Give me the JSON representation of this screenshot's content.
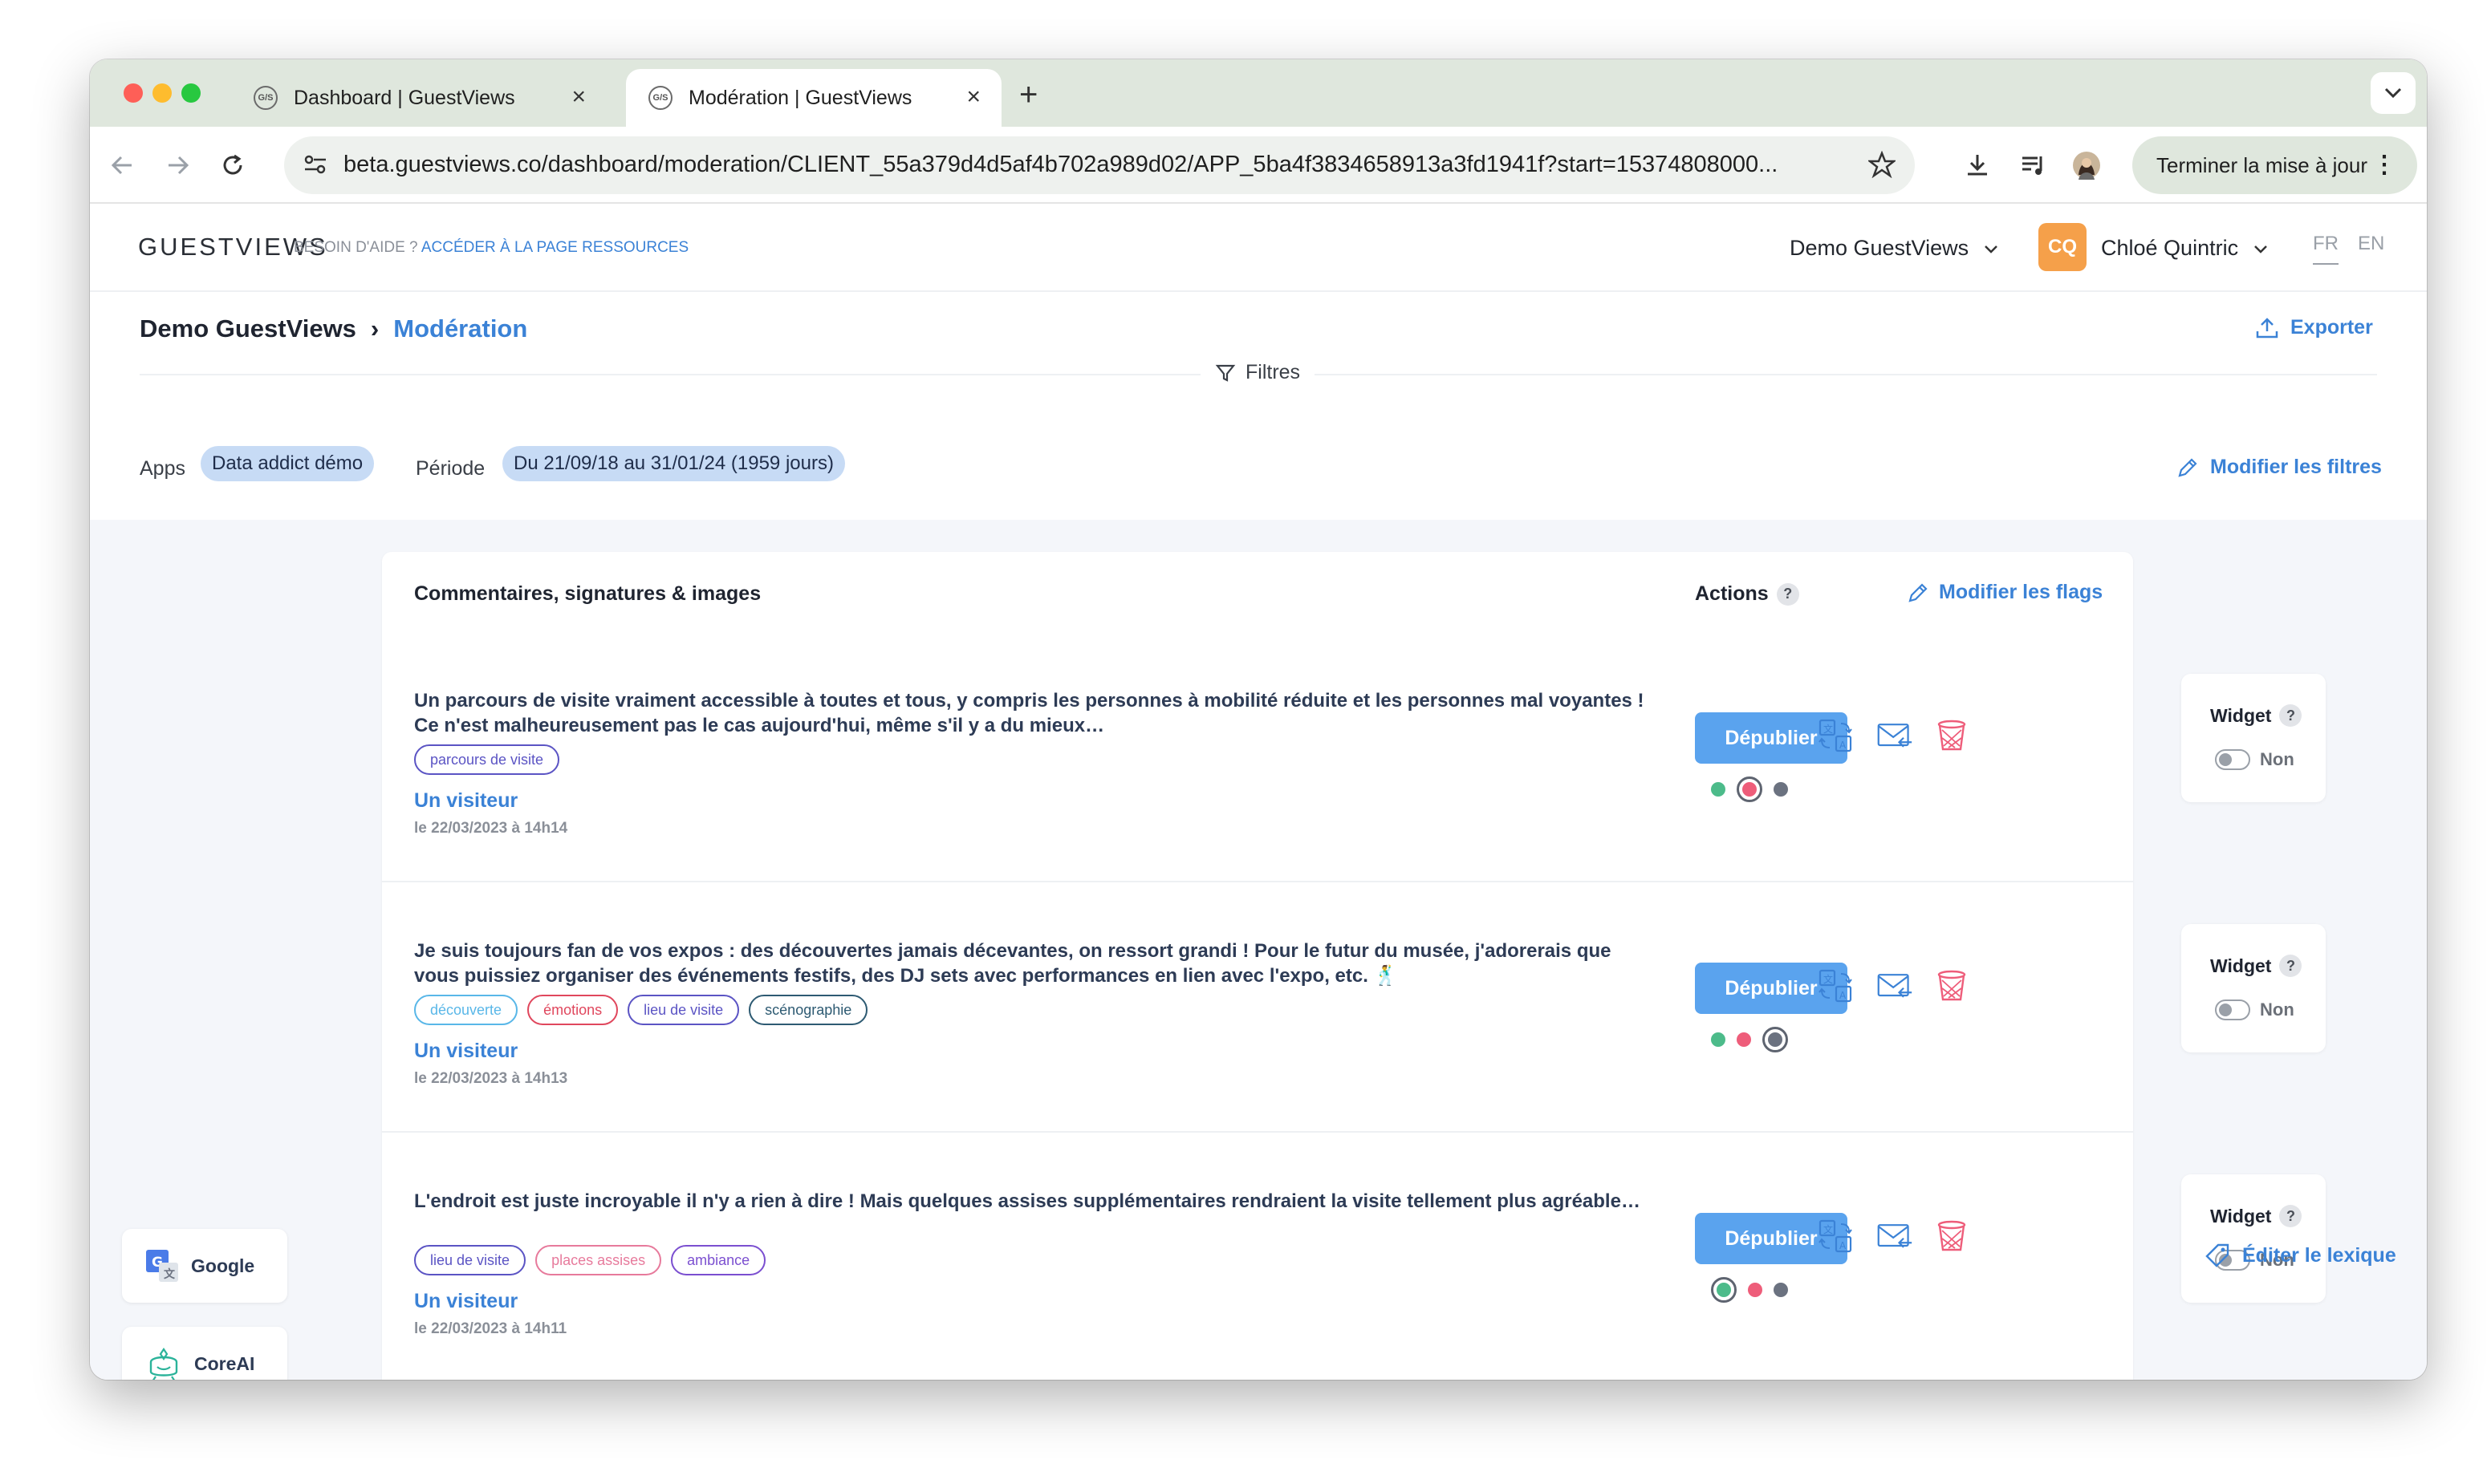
{
  "browser": {
    "tabs": [
      {
        "label": "Dashboard | GuestViews",
        "favicon": "G/S"
      },
      {
        "label": "Modération | GuestViews",
        "favicon": "G/S"
      }
    ],
    "url": "beta.guestviews.co/dashboard/moderation/CLIENT_55a379d4d5af4b702a989d02/APP_5ba4f3834658913a3fd1941f?start=15374808000...",
    "update_label": "Terminer la mise à jour"
  },
  "header": {
    "logo": "GUESTVIEWS",
    "help_prefix": "BESOIN D'AIDE ?",
    "help_link": "ACCÉDER À LA PAGE RESSOURCES",
    "org": "Demo GuestViews",
    "avatar_initials": "CQ",
    "user": "Chloé Quintric",
    "lang_fr": "FR",
    "lang_en": "EN"
  },
  "breadcrumb": {
    "org": "Demo GuestViews",
    "page": "Modération"
  },
  "export_label": "Exporter",
  "filters": {
    "label": "Filtres",
    "apps_label": "Apps",
    "apps_value": "Data addict démo",
    "period_label": "Période",
    "period_value": "Du 21/09/18 au 31/01/24 (1959 jours)",
    "edit_label": "Modifier les filtres"
  },
  "card": {
    "title": "Commentaires, signatures & images",
    "actions_label": "Actions",
    "actions_help": "?",
    "edit_flags": "Modifier les flags",
    "publish_label": "Dépublier",
    "widget_label": "Widget",
    "widget_help": "?",
    "widget_value": "Non",
    "status_colors": {
      "green": "#4cbb8a",
      "red": "#ee5d7a",
      "grey": "#6b7280"
    },
    "items": [
      {
        "text": "Un parcours de visite vraiment accessible à toutes et tous, y compris les personnes à mobilité réduite et les personnes mal voyantes ! Ce n'est malheureusement pas le cas aujourd'hui, même s'il y a du mieux…",
        "tags": [
          {
            "label": "parcours de visite",
            "color": "#5b54c4"
          }
        ],
        "author": "Un visiteur",
        "date": "le 22/03/2023 à 14h14",
        "selected_status": "red"
      },
      {
        "text": "Je suis toujours fan de vos expos : des découvertes jamais décevantes, on ressort grandi ! Pour le futur du musée, j'adorerais que vous puissiez organiser des événements festifs, des DJ sets avec performances en lien avec l'expo, etc. 🕺",
        "tags": [
          {
            "label": "découverte",
            "color": "#59b7e8"
          },
          {
            "label": "émotions",
            "color": "#e0475d"
          },
          {
            "label": "lieu de visite",
            "color": "#5b54c4"
          },
          {
            "label": "scénographie",
            "color": "#2d5a72"
          }
        ],
        "author": "Un visiteur",
        "date": "le 22/03/2023 à 14h13",
        "selected_status": "grey"
      },
      {
        "text": "L'endroit est juste incroyable il n'y a rien à dire ! Mais quelques assises supplémentaires rendraient la visite tellement plus agréable…",
        "tags": [
          {
            "label": "lieu de visite",
            "color": "#5b54c4"
          },
          {
            "label": "places assises",
            "color": "#e77a9c"
          },
          {
            "label": "ambiance",
            "color": "#7b4fd0"
          }
        ],
        "author": "Un visiteur",
        "date": "le 22/03/2023 à 14h11",
        "selected_status": "green"
      }
    ]
  },
  "side_buttons": {
    "google": "Google",
    "coreai": "CoreAI"
  },
  "lexique_label": "Éditer le lexique"
}
